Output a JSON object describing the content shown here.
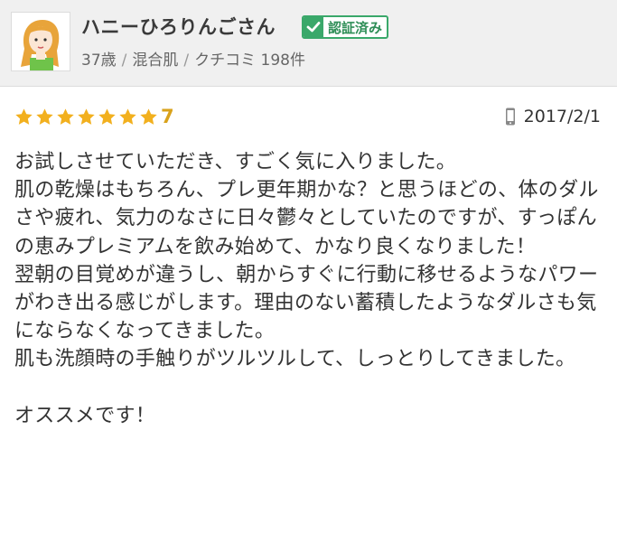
{
  "user": {
    "name": "ハニーひろりんごさん",
    "badge_label": "認証済み",
    "age": "37歳",
    "skin_type": "混合肌",
    "review_count": "クチコミ 198件"
  },
  "review": {
    "rating_stars_filled": 7,
    "rating_stars_total": 7,
    "rating_value": "7",
    "date": "2017/2/1",
    "lines": [
      "お試しさせていただき、すごく気に入りました。",
      "肌の乾燥はもちろん、プレ更年期かな？と思うほどの、体のダルさや疲れ、気力のなさに日々鬱々としていたのですが、すっぽんの恵みプレミアムを飲み始めて、かなり良くなりました！",
      "翌朝の目覚めが違うし、朝からすぐに行動に移せるようなパワーがわき出る感じがします。理由のない蓄積したようなダルさも気にならなくなってきました。",
      "肌も洗顔時の手触りがツルツルして、しっとりしてきました。",
      "",
      "オススメです！"
    ]
  },
  "colors": {
    "header_bg": "#f0f0f0",
    "star": "#f2b01e",
    "rating_text": "#d9a21b",
    "badge_green": "#3aa86a"
  },
  "icons": {
    "badge": "check-icon",
    "device": "mobile-phone-icon",
    "rating": "star-icon"
  }
}
